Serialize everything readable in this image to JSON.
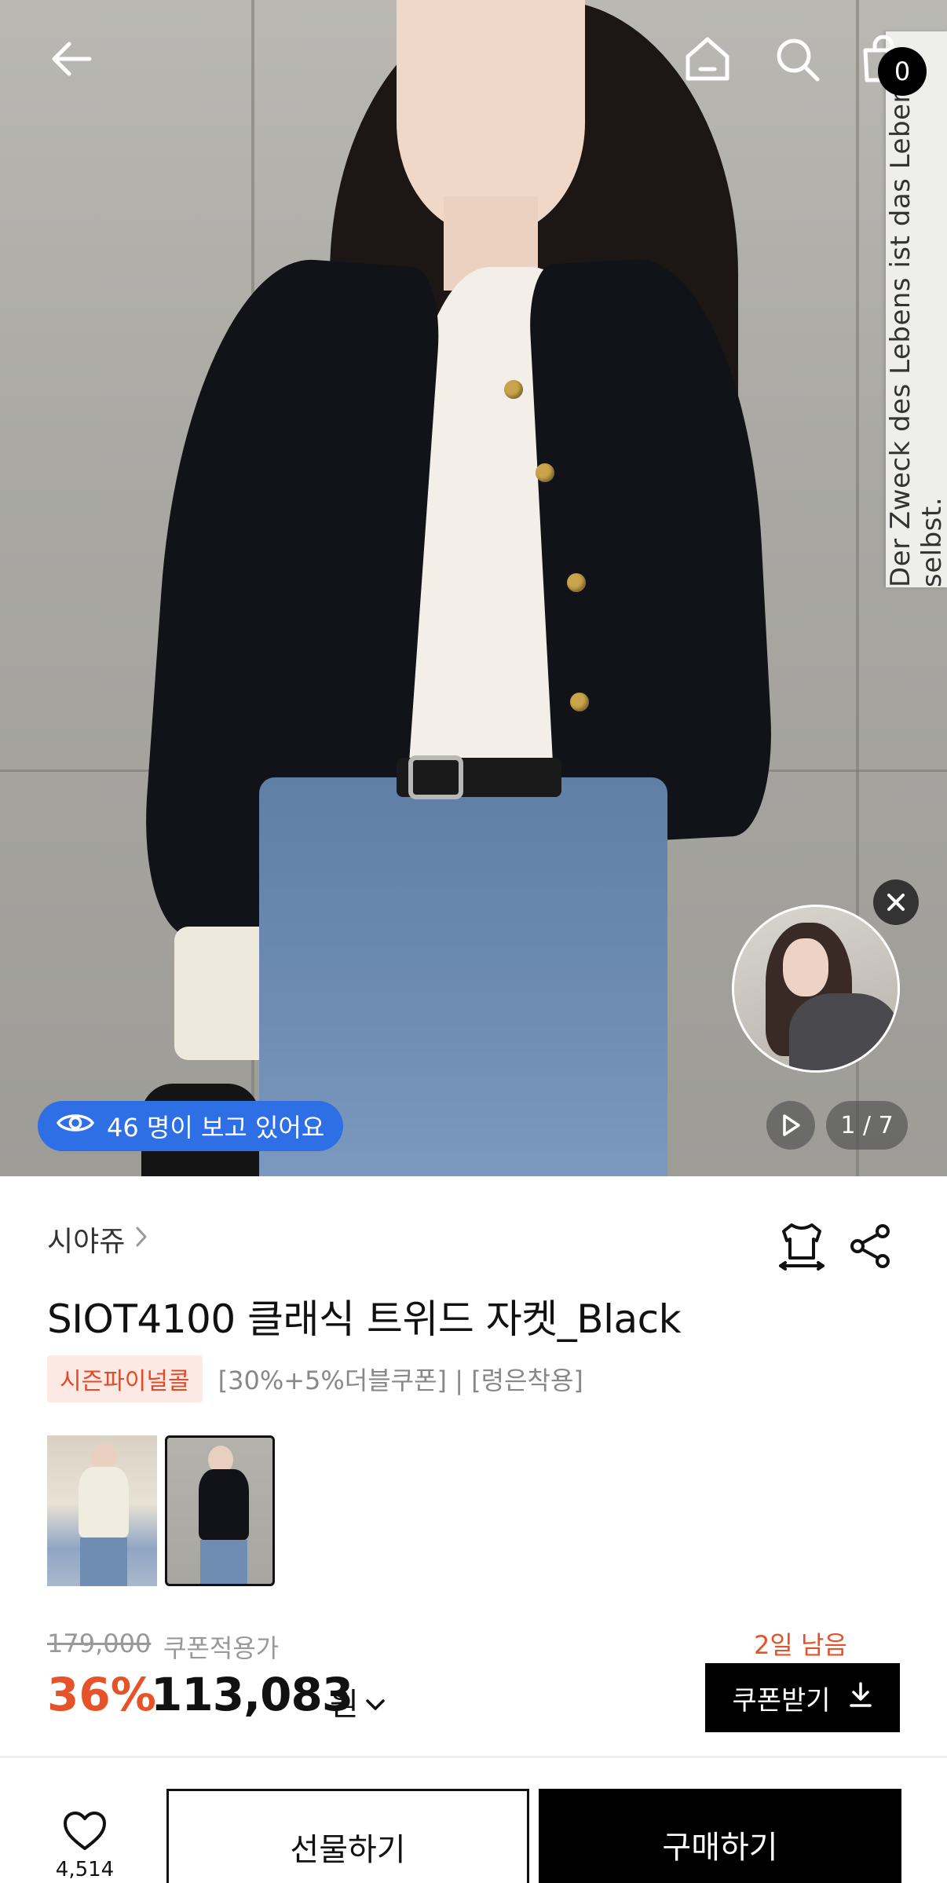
{
  "header": {
    "cart_count": "0"
  },
  "hero": {
    "viewers_text": "46 명이 보고 있어요",
    "image_counter": "1 / 7",
    "sign_text": "Der Zweck des Lebens ist das Leben selbst."
  },
  "product": {
    "brand": "시야쥬",
    "title": "SIOT4100 클래식 트위드 자켓_Black",
    "tag": "시즌파이널콜",
    "tag_description": "[30%+5%더블쿠폰] | [령은착용]",
    "original_price": "179,000",
    "coupon_label": "쿠폰적용가",
    "discount": "36%",
    "price": "113,083",
    "currency": "원",
    "days_left": "2일 남음",
    "coupon_button": "쿠폰받기"
  },
  "bottom_bar": {
    "like_count": "4,514",
    "gift_button": "선물하기",
    "buy_button": "구매하기"
  },
  "colors": {
    "accent": "#e6532b",
    "viewers_pill": "#2f6fe6",
    "tag_bg": "#fde9e3"
  },
  "icons": [
    "back-arrow-icon",
    "home-icon",
    "search-icon",
    "cart-icon",
    "eye-icon",
    "play-icon",
    "close-icon",
    "chevron-right-icon",
    "hanger-size-icon",
    "share-icon",
    "chevron-down-icon",
    "download-icon",
    "heart-icon"
  ]
}
